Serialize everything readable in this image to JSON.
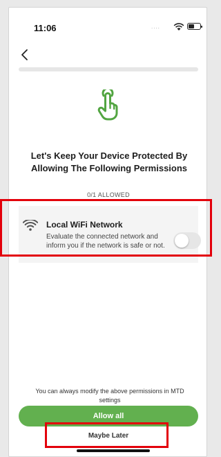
{
  "status_bar": {
    "time": "11:06",
    "signal_dots": "....",
    "wifi_icon": "wifi-icon",
    "battery_icon": "battery-icon"
  },
  "nav": {
    "back_icon": "chevron-left-icon"
  },
  "hero": {
    "icon": "tap-hand-icon",
    "icon_color": "#52a541",
    "title": "Let's Keep Your Device Protected By Allowing The Following Permissions",
    "allowed_count": "0/1 ALLOWED"
  },
  "permission": {
    "icon": "wifi-icon",
    "title": "Local WiFi Network",
    "description": "Evaluate the connected network and inform you if the network is safe or not.",
    "enabled": false
  },
  "footer": {
    "note": "You can always modify the above permissions in MTD settings",
    "allow_all_label": "Allow all",
    "allow_all_color": "#62b04f",
    "maybe_later_label": "Maybe Later"
  },
  "annotations": {
    "highlight_color": "#e3000b"
  }
}
